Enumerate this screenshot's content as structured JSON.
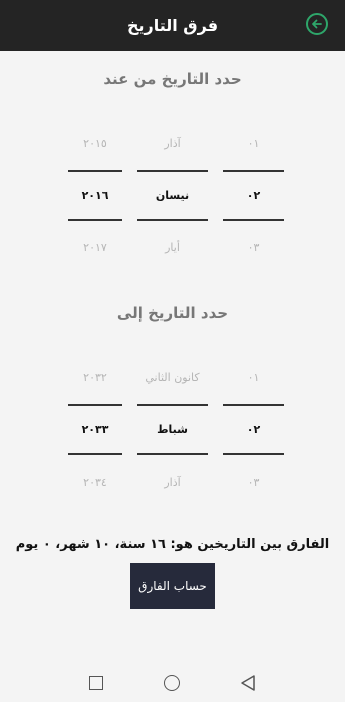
{
  "appbar": {
    "title": "فرق التاريخ",
    "back_icon": "arrow-left-circle-icon",
    "accent": "#2ea66a"
  },
  "from_section": {
    "title": "حدد التاريخ من عند",
    "days": [
      "٠١",
      "٠٢",
      "٠٣"
    ],
    "months": [
      "آذار",
      "نيسان",
      "أيار"
    ],
    "years": [
      "٢٠١٥",
      "٢٠١٦",
      "٢٠١٧"
    ]
  },
  "to_section": {
    "title": "حدد التاريخ إلى",
    "days": [
      "٠١",
      "٠٢",
      "٠٣"
    ],
    "months": [
      "كانون الثاني",
      "شباط",
      "آذار"
    ],
    "years": [
      "٢٠٣٢",
      "٢٠٣٣",
      "٢٠٣٤"
    ]
  },
  "result": {
    "text": "الفارق بين التاريخين هو: ١٦ سنة، ١٠ شهر، ٠ يوم"
  },
  "calc_button": {
    "label": "حساب الفارق",
    "color": "#262a3b"
  },
  "navbar": {
    "icons": [
      "square-icon",
      "circle-icon",
      "triangle-back-icon"
    ]
  }
}
